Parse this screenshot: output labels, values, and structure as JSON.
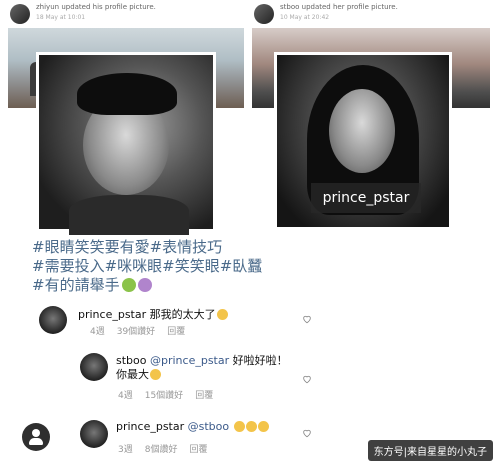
{
  "posts": {
    "left": {
      "author": "zhiyun",
      "action": "updated his profile picture.",
      "date": "18 May at 10:01"
    },
    "right": {
      "author": "stboo",
      "action": "updated her profile picture.",
      "date": "10 May at 20:42"
    },
    "photo_tag": "prince_pstar"
  },
  "caption": {
    "lines": [
      "#眼睛笑笑要有愛#表情技巧",
      "#需要投入#咪咪眼#笑笑眼#臥蠶",
      "#有的請舉手"
    ]
  },
  "comments": [
    {
      "user": "prince_pstar",
      "text": "那我的太大了",
      "meta": [
        "4週",
        "39個讚好",
        "回覆"
      ]
    },
    {
      "user": "stboo",
      "mention": "@prince_pstar",
      "text": "好啦好啦！",
      "text2": "你最大",
      "meta": [
        "4週",
        "15個讚好",
        "回覆"
      ]
    },
    {
      "user": "prince_pstar",
      "mention": "@stboo",
      "text": "",
      "meta": [
        "3週",
        "8個讚好",
        "回覆"
      ]
    }
  ],
  "watermark": "东方号|来自星星的小丸子",
  "colors": {
    "hashtag": "#4a6a8a",
    "meta": "#999999"
  }
}
